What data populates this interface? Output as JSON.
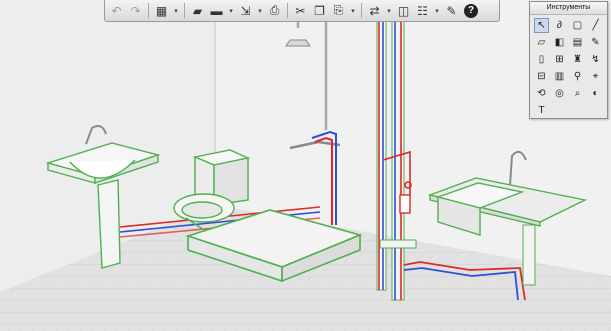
{
  "toolbar": {
    "buttons": [
      {
        "name": "undo-icon",
        "glyph": "↶",
        "dim": true
      },
      {
        "name": "redo-icon",
        "glyph": "↷",
        "dim": true
      },
      {
        "sep": true
      },
      {
        "name": "view-3d-icon",
        "glyph": "▦"
      },
      {
        "name": "view-3d-dropdown",
        "glyph": "▾",
        "dd": true
      },
      {
        "sep": true
      },
      {
        "name": "open-folder-icon",
        "glyph": "▰"
      },
      {
        "name": "save-icon",
        "glyph": "▬"
      },
      {
        "name": "save-dropdown",
        "glyph": "▾",
        "dd": true
      },
      {
        "name": "export-icon",
        "glyph": "⇲"
      },
      {
        "name": "export-dropdown",
        "glyph": "▾",
        "dd": true
      },
      {
        "name": "print-icon",
        "glyph": "⎙"
      },
      {
        "sep": true
      },
      {
        "name": "cut-icon",
        "glyph": "✂"
      },
      {
        "name": "copy-icon",
        "glyph": "❐"
      },
      {
        "name": "paste-icon",
        "glyph": "⎘"
      },
      {
        "name": "paste-dropdown",
        "glyph": "▾",
        "dd": true
      },
      {
        "sep": true
      },
      {
        "name": "connect-icon",
        "glyph": "⇄"
      },
      {
        "name": "connect-dropdown",
        "glyph": "▾",
        "dd": true
      },
      {
        "name": "layers-icon",
        "glyph": "◫"
      },
      {
        "name": "properties-icon",
        "glyph": "☷"
      },
      {
        "name": "properties-dropdown",
        "glyph": "▾",
        "dd": true
      },
      {
        "name": "settings-icon",
        "glyph": "✎"
      },
      {
        "name": "help-icon",
        "glyph": "?",
        "help": true
      }
    ]
  },
  "palette": {
    "title": "Инструменты",
    "tools": [
      {
        "name": "select-tool-icon",
        "glyph": "↖",
        "active": true
      },
      {
        "name": "link-tool-icon",
        "glyph": "∂"
      },
      {
        "name": "room-tool-icon",
        "glyph": "▢"
      },
      {
        "name": "wall-tool-icon",
        "glyph": "╱"
      },
      {
        "name": "floor-tool-icon",
        "glyph": "▱"
      },
      {
        "name": "slab-tool-icon",
        "glyph": "◧"
      },
      {
        "name": "stairs-tool-icon",
        "glyph": "▤"
      },
      {
        "name": "pencil-tool-icon",
        "glyph": "✎"
      },
      {
        "name": "door-tool-icon",
        "glyph": "▯"
      },
      {
        "name": "window-tool-icon",
        "glyph": "⊞"
      },
      {
        "name": "furniture-tool-icon",
        "glyph": "♜"
      },
      {
        "name": "pipe-tool-icon",
        "glyph": "↯"
      },
      {
        "name": "fixture-tool-icon",
        "glyph": "⊟"
      },
      {
        "name": "label-tool-icon",
        "glyph": "▥"
      },
      {
        "name": "dimension-tool-icon",
        "glyph": "⚲"
      },
      {
        "name": "measure-tool-icon",
        "glyph": "⌖"
      },
      {
        "name": "rotate-tool-icon",
        "glyph": "⟲"
      },
      {
        "name": "camera-tool-icon",
        "glyph": "◎"
      },
      {
        "name": "zoom-tool-icon",
        "glyph": "⌕"
      },
      {
        "name": "light-tool-icon",
        "glyph": "◐"
      },
      {
        "name": "text-tool-icon",
        "glyph": "T"
      }
    ]
  }
}
